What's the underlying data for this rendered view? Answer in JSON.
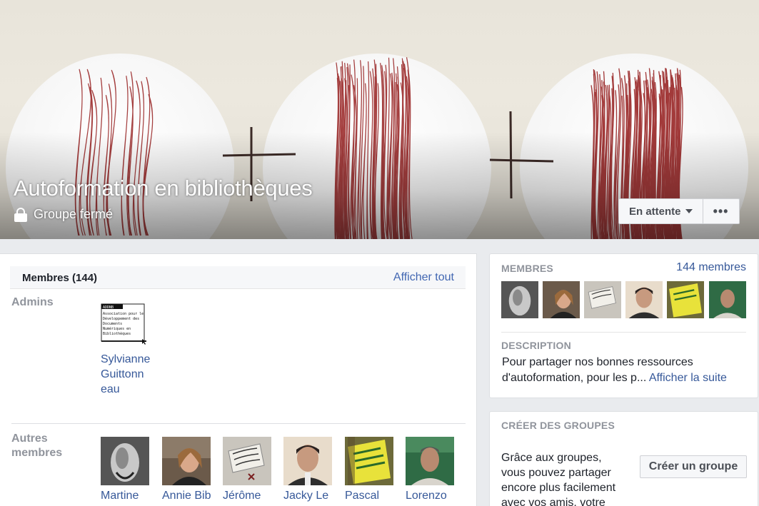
{
  "cover": {
    "group_name": "Autoformation en bibliothèques",
    "privacy": "Groupe fermé",
    "privacy_icon": "lock-icon",
    "pending_label": "En attente",
    "more_label": "•••"
  },
  "members_section": {
    "title": "Membres (144)",
    "see_all": "Afficher tout",
    "admins_label": "Admins",
    "admin_logo_text": [
      "ADDNB",
      "Association pour le",
      "Développement des",
      "Documents",
      "Numériques en",
      "Bibliothèques"
    ],
    "admin": {
      "name": "Sylvianne Guittonneau",
      "name_lines": [
        "Sylvianne",
        "Guittonn",
        "eau"
      ]
    },
    "others_label_lines": [
      "Autres",
      "membres"
    ],
    "others": [
      {
        "name": "Martine"
      },
      {
        "name": "Annie Bib"
      },
      {
        "name": "Jérôme"
      },
      {
        "name": "Jacky Le"
      },
      {
        "name": "Pascal"
      },
      {
        "name": "Lorenzo"
      }
    ]
  },
  "sidebar": {
    "members_heading": "MEMBRES",
    "members_count": "144 membres",
    "description_heading": "DESCRIPTION",
    "description_text": "Pour partager nos bonnes ressources d'autoformation, pour les p...",
    "description_more": "Afficher la suite",
    "create_heading": "CRÉER DES GROUPES",
    "create_text": "Grâce aux groupes, vous pouvez partager encore plus facilement avec vos amis, votre",
    "create_button": "Créer un groupe"
  },
  "colors": {
    "link": "#365899",
    "heading_grey": "#90949c",
    "background": "#e9ebee",
    "scribble_red": "#9b2a2a"
  }
}
